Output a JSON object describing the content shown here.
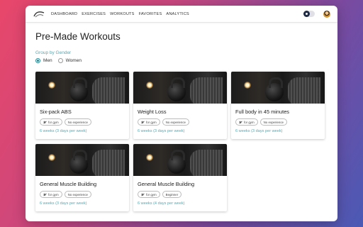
{
  "nav": {
    "links": [
      "DASHBOARD",
      "EXERCISES",
      "WORKOUTS",
      "FAVORITES",
      "ANALYTICS"
    ]
  },
  "page": {
    "title": "Pre-Made Workouts",
    "group_label": "Group by Gender",
    "options": [
      {
        "label": "Men",
        "checked": true
      },
      {
        "label": "Women",
        "checked": false
      }
    ]
  },
  "workouts": [
    {
      "title": "Six-pack ABS",
      "tags": [
        "for gym",
        "No experience"
      ],
      "duration": "6 weeks (3 days per week)"
    },
    {
      "title": "Weight Loss",
      "tags": [
        "for gym",
        "No experience"
      ],
      "duration": "6 weeks (3 days per week)"
    },
    {
      "title": "Full body in 45 minutes",
      "tags": [
        "for gym",
        "No experience"
      ],
      "duration": "6 weeks (3 days per week)"
    },
    {
      "title": "General Muscle Building",
      "tags": [
        "for gym",
        "No experience"
      ],
      "duration": "6 weeks (3 days per week)"
    },
    {
      "title": "General Muscle Building",
      "tags": [
        "for gym",
        "Beginner"
      ],
      "duration": "6 weeks (4 days per week)"
    }
  ],
  "colors": {
    "accent": "#2d8a95",
    "duration_text": "#5aa7b0"
  },
  "icons": {
    "logo": "logo-icon",
    "theme_toggle": "theme-toggle",
    "avatar": "user-avatar",
    "gym_tag": "dumbbell-icon"
  }
}
